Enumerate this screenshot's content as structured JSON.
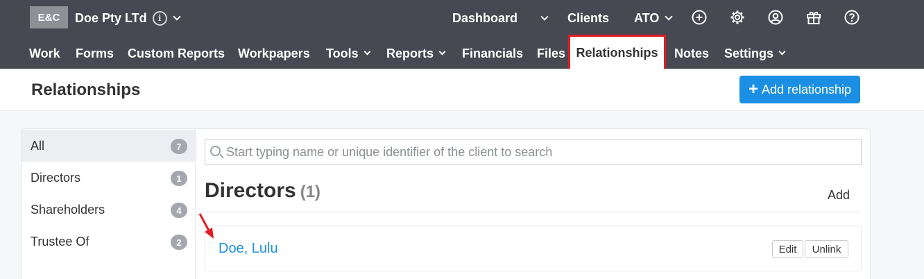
{
  "topbar": {
    "logo": "E&C",
    "org_name": "Doe Pty LTd",
    "info_glyph": "i",
    "nav": {
      "dashboard": "Dashboard",
      "clients": "Clients",
      "ato": "ATO"
    },
    "icons": [
      "add-circle-icon",
      "gear-icon",
      "user-circle-icon",
      "gift-icon",
      "help-circle-icon"
    ]
  },
  "mainnav": {
    "work": "Work",
    "forms": "Forms",
    "custom_reports": "Custom Reports",
    "workpapers": "Workpapers",
    "tools": "Tools",
    "reports": "Reports",
    "financials": "Financials",
    "files": "Files",
    "relationships": "Relationships",
    "notes": "Notes",
    "settings": "Settings"
  },
  "header": {
    "title": "Relationships",
    "add_button": "Add relationship",
    "add_button_icon": "+"
  },
  "sidebar": {
    "items": [
      {
        "label": "All",
        "count": "7"
      },
      {
        "label": "Directors",
        "count": "1"
      },
      {
        "label": "Shareholders",
        "count": "4"
      },
      {
        "label": "Trustee Of",
        "count": "2"
      }
    ]
  },
  "search": {
    "placeholder": "Start typing name or unique identifier of the client to search"
  },
  "section": {
    "title": "Directors",
    "count": "(1)",
    "add_label": "Add"
  },
  "relationship": {
    "name": "Doe, Lulu",
    "edit_label": "Edit",
    "unlink_label": "Unlink"
  },
  "colors": {
    "topbar": "#474851",
    "accent": "#1a8fe3",
    "highlight": "#e11d23"
  }
}
